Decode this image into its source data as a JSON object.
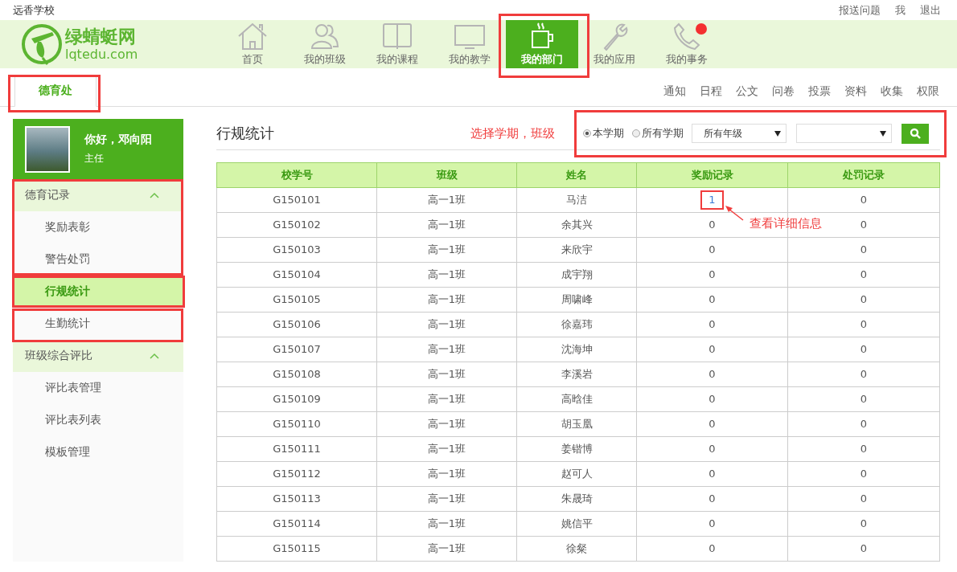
{
  "top_bar": {
    "school": "远香学校",
    "links": [
      "报送问题",
      "我",
      "退出"
    ]
  },
  "logo": {
    "name": "绿蜻蜓网",
    "domain": "lqtedu.com"
  },
  "nav": [
    {
      "label": "首页",
      "kind": "home",
      "selected": false,
      "badge": false
    },
    {
      "label": "我的班级",
      "kind": "people",
      "selected": false,
      "badge": false
    },
    {
      "label": "我的课程",
      "kind": "book",
      "selected": false,
      "badge": false
    },
    {
      "label": "我的教学",
      "kind": "monitor",
      "selected": false,
      "badge": false
    },
    {
      "label": "我的部门",
      "kind": "cup",
      "selected": true,
      "badge": false
    },
    {
      "label": "我的应用",
      "kind": "wrench",
      "selected": false,
      "badge": false
    },
    {
      "label": "我的事务",
      "kind": "phone",
      "selected": false,
      "badge": true
    }
  ],
  "dept_tab": {
    "label": "德育处"
  },
  "dept_links": [
    "通知",
    "日程",
    "公文",
    "问卷",
    "投票",
    "资料",
    "收集",
    "权限"
  ],
  "profile": {
    "greeting": "你好，邓向阳",
    "role": "主任"
  },
  "sidebar": [
    {
      "label": "德育记录",
      "expanded": true,
      "children": [
        {
          "label": "奖励表彰",
          "selected": false
        },
        {
          "label": "警告处罚",
          "selected": false
        },
        {
          "label": "行规统计",
          "selected": true
        },
        {
          "label": "生勤统计",
          "selected": false
        }
      ]
    },
    {
      "label": "班级综合评比",
      "expanded": true,
      "children": [
        {
          "label": "评比表管理",
          "selected": false
        },
        {
          "label": "评比表列表",
          "selected": false
        },
        {
          "label": "模板管理",
          "selected": false
        }
      ]
    }
  ],
  "page_title": "行规统计",
  "filter_hint": "选择学期，班级",
  "filters": {
    "terms": [
      {
        "label": "本学期",
        "selected": true
      },
      {
        "label": "所有学期",
        "selected": false
      }
    ],
    "grade_select": "所有年级"
  },
  "detail_hint": "查看详细信息",
  "table": {
    "columns": [
      "校学号",
      "班级",
      "姓名",
      "奖励记录",
      "处罚记录"
    ],
    "rows": [
      {
        "id": "G150101",
        "class": "高一1班",
        "name": "马洁",
        "reward": "1",
        "reward_link": true,
        "penalty": "0"
      },
      {
        "id": "G150102",
        "class": "高一1班",
        "name": "余其兴",
        "reward": "0",
        "reward_link": false,
        "penalty": "0"
      },
      {
        "id": "G150103",
        "class": "高一1班",
        "name": "来欣宇",
        "reward": "0",
        "reward_link": false,
        "penalty": "0"
      },
      {
        "id": "G150104",
        "class": "高一1班",
        "name": "成宇翔",
        "reward": "0",
        "reward_link": false,
        "penalty": "0"
      },
      {
        "id": "G150105",
        "class": "高一1班",
        "name": "周啸峰",
        "reward": "0",
        "reward_link": false,
        "penalty": "0"
      },
      {
        "id": "G150106",
        "class": "高一1班",
        "name": "徐嘉玮",
        "reward": "0",
        "reward_link": false,
        "penalty": "0"
      },
      {
        "id": "G150107",
        "class": "高一1班",
        "name": "沈海坤",
        "reward": "0",
        "reward_link": false,
        "penalty": "0"
      },
      {
        "id": "G150108",
        "class": "高一1班",
        "name": "李溪岩",
        "reward": "0",
        "reward_link": false,
        "penalty": "0"
      },
      {
        "id": "G150109",
        "class": "高一1班",
        "name": "高晗佳",
        "reward": "0",
        "reward_link": false,
        "penalty": "0"
      },
      {
        "id": "G150110",
        "class": "高一1班",
        "name": "胡玉凰",
        "reward": "0",
        "reward_link": false,
        "penalty": "0"
      },
      {
        "id": "G150111",
        "class": "高一1班",
        "name": "姜锴博",
        "reward": "0",
        "reward_link": false,
        "penalty": "0"
      },
      {
        "id": "G150112",
        "class": "高一1班",
        "name": "赵可人",
        "reward": "0",
        "reward_link": false,
        "penalty": "0"
      },
      {
        "id": "G150113",
        "class": "高一1班",
        "name": "朱晟琦",
        "reward": "0",
        "reward_link": false,
        "penalty": "0"
      },
      {
        "id": "G150114",
        "class": "高一1班",
        "name": "姚信平",
        "reward": "0",
        "reward_link": false,
        "penalty": "0"
      },
      {
        "id": "G150115",
        "class": "高一1班",
        "name": "徐粲",
        "reward": "0",
        "reward_link": false,
        "penalty": "0"
      }
    ]
  }
}
